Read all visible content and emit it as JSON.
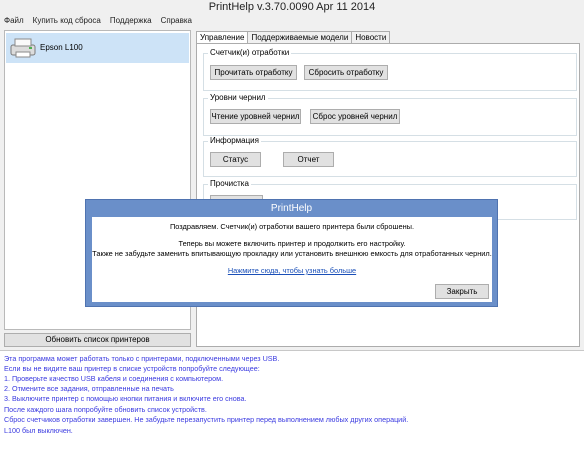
{
  "window": {
    "title": "PrintHelp v.3.70.0090 Apr 11 2014"
  },
  "menu": [
    "Файл",
    "Купить код сброса",
    "Поддержка",
    "Справка"
  ],
  "printers": [
    {
      "name": "Epson L100"
    }
  ],
  "refresh_button": "Обновить список принтеров",
  "tabs": [
    "Управление",
    "Поддерживаемые модели",
    "Новости"
  ],
  "groups": {
    "waste": {
      "title": "Счетчик(и) отработки",
      "read": "Прочитать отработку",
      "reset": "Сбросить отработку"
    },
    "ink": {
      "title": "Уровни чернил",
      "read": "Чтение уровней чернил",
      "reset": "Сброс уровней чернил"
    },
    "info": {
      "title": "Информация",
      "status": "Статус",
      "report": "Отчет"
    },
    "clean": {
      "title": "Прочистка"
    }
  },
  "dialog": {
    "title": "PrintHelp",
    "line1": "Поздравляем. Счетчик(и) отработки вашего принтера были сброшены.",
    "line2": "Теперь вы можете включить принтер и продолжить его настройку.",
    "line3": "Также не забудьте заменить впитывающую прокладку или установить внешнюю емкость для отработанных чернил.",
    "link": "Нажмите сюда, чтобы узнать больше",
    "close": "Закрыть"
  },
  "log": [
    "Эта программа может работать только с принтерами, подключенными через USB.",
    "Если вы не видите ваш принтер в списке устройств попробуйте следующее:",
    "1. Проверьте качество USB кабеля и соединения с компьютером.",
    "2. Отмените все задания, отправленные на печать",
    "3. Выключите принтер с помощью кнопки питания и включите его снова.",
    "После каждого шага попробуйте обновить список устройств.",
    "Сброс счетчиков отработки завершен. Не забудьте перезапустить принтер перед выполнением любых других операций.",
    "L100 был выключен."
  ]
}
